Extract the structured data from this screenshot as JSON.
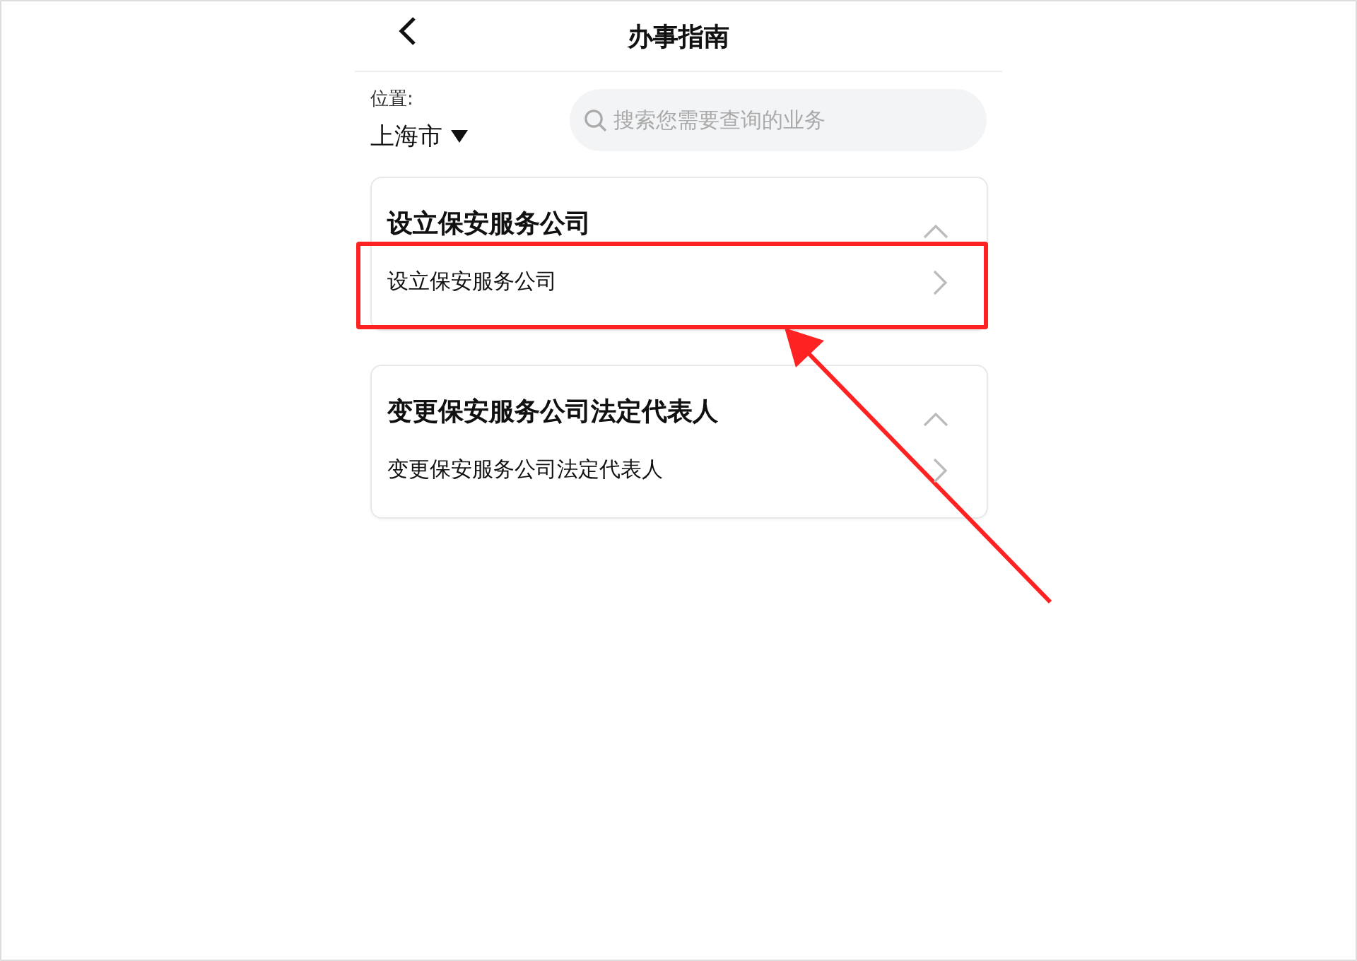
{
  "header": {
    "title": "办事指南"
  },
  "location": {
    "label": "位置:",
    "value": "上海市"
  },
  "search": {
    "placeholder": "搜索您需要查询的业务"
  },
  "sections": [
    {
      "title": "设立保安服务公司",
      "expanded": true,
      "items": [
        {
          "label": "设立保安服务公司",
          "highlighted": true
        }
      ]
    },
    {
      "title": "变更保安服务公司法定代表人",
      "expanded": true,
      "items": [
        {
          "label": "变更保安服务公司法定代表人",
          "highlighted": false
        }
      ]
    }
  ]
}
